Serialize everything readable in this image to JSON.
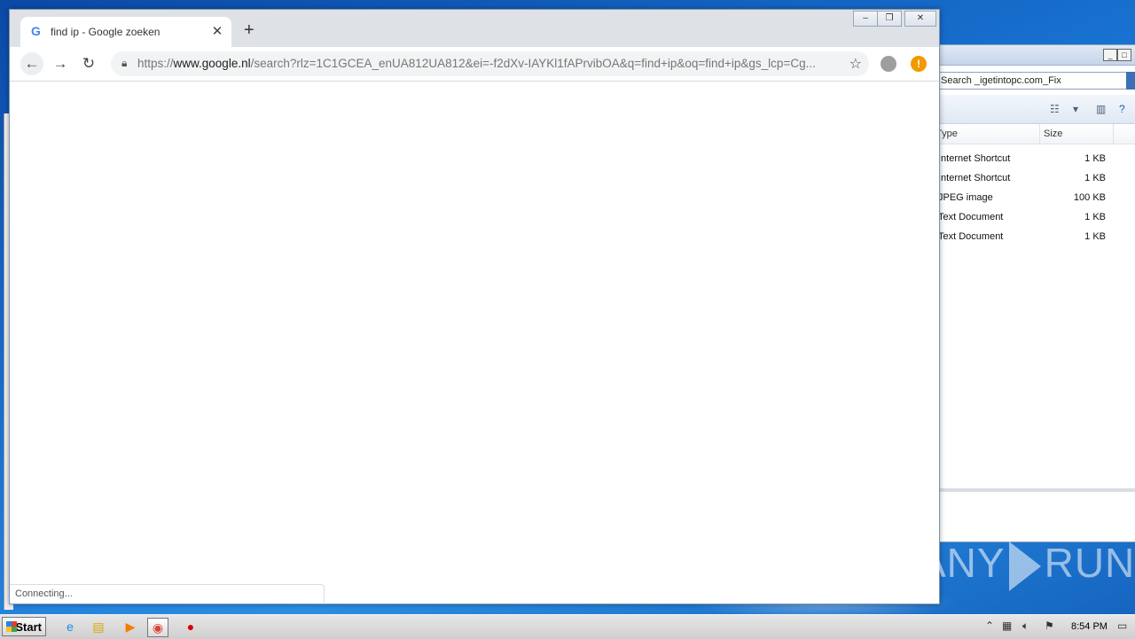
{
  "chrome": {
    "tab_title": "find ip - Google zoeken",
    "url_scheme": "https://",
    "url_host": "www.google.nl",
    "url_rest": "/search?rlz=1C1GCEA_enUA812UA812&ei=-f2dXv-IAYKl1fAPrvibOA&q=find+ip&oq=find+ip&gs_lcp=Cg...",
    "status_text": "Connecting..."
  },
  "explorer": {
    "search_placeholder": "Search _igetintopc.com_Fix",
    "columns": {
      "type": "Type",
      "size": "Size"
    },
    "rows": [
      {
        "type": "Internet Shortcut",
        "size": "1 KB"
      },
      {
        "type": "Internet Shortcut",
        "size": "1 KB"
      },
      {
        "type": "JPEG image",
        "size": "100 KB"
      },
      {
        "type": "Text Document",
        "size": "1 KB"
      },
      {
        "type": "Text Document",
        "size": "1 KB"
      }
    ]
  },
  "taskbar": {
    "start_label": "Start",
    "clock": "8:54 PM"
  },
  "watermark": {
    "left": "ANY",
    "right": "RUN"
  },
  "icons": [
    "google-g-icon",
    "close-icon",
    "plus-icon",
    "back-icon",
    "forward-icon",
    "reload-icon",
    "lock-icon",
    "star-icon",
    "profile-icon",
    "update-alert-icon"
  ]
}
